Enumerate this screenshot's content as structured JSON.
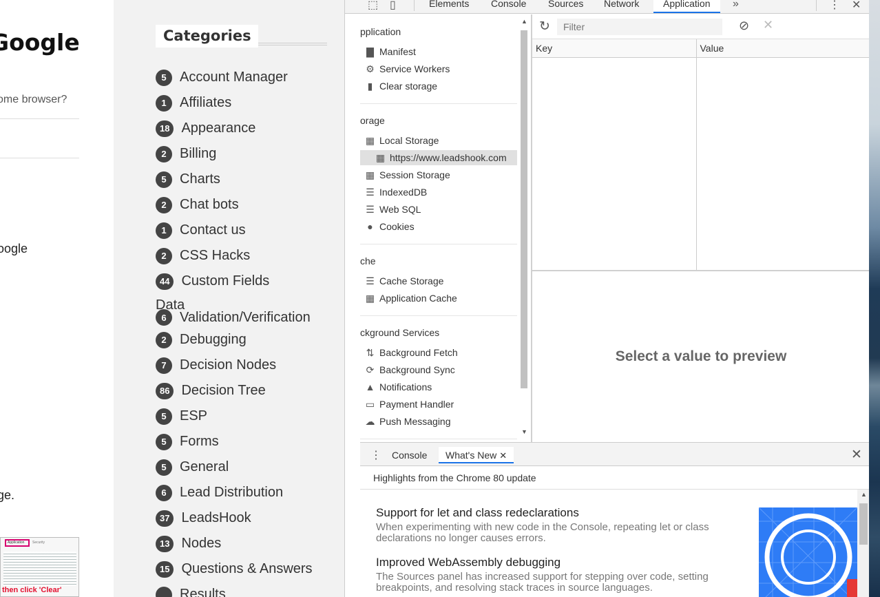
{
  "article": {
    "title_fragment": "Google",
    "question_fragment": "ome browser?",
    "text_fragment_1": "oogle",
    "text_fragment_2": "ge.",
    "thumbnail": {
      "tab_active": "Application",
      "tab_other": "Security",
      "caption": "then click 'Clear'"
    }
  },
  "categories": {
    "heading": "Categories",
    "items": [
      {
        "count": "5",
        "name": "Account Manager"
      },
      {
        "count": "1",
        "name": "Affiliates"
      },
      {
        "count": "18",
        "name": "Appearance"
      },
      {
        "count": "2",
        "name": "Billing"
      },
      {
        "count": "5",
        "name": "Charts"
      },
      {
        "count": "2",
        "name": "Chat bots"
      },
      {
        "count": "1",
        "name": "Contact us"
      },
      {
        "count": "2",
        "name": "CSS Hacks"
      },
      {
        "count": "44",
        "name": "Custom Fields"
      },
      {
        "prefix": "Data",
        "count": "6",
        "name": "Validation/Verification"
      },
      {
        "count": "2",
        "name": "Debugging"
      },
      {
        "count": "7",
        "name": "Decision Nodes"
      },
      {
        "count": "86",
        "name": "Decision Tree"
      },
      {
        "count": "5",
        "name": "ESP"
      },
      {
        "count": "5",
        "name": "Forms"
      },
      {
        "count": "5",
        "name": "General"
      },
      {
        "count": "6",
        "name": "Lead Distribution"
      },
      {
        "count": "37",
        "name": "LeadsHook"
      },
      {
        "count": "13",
        "name": "Nodes"
      },
      {
        "count": "15",
        "name": "Questions & Answers"
      },
      {
        "count": "",
        "name": "Results"
      }
    ]
  },
  "devtools": {
    "tabs": [
      "Elements",
      "Console",
      "Sources",
      "Network",
      "Application"
    ],
    "active_tab": "Application",
    "more_tabs_icon": "»",
    "sidebar": {
      "application": {
        "label": "pplication",
        "items": [
          {
            "icon": "file-icon",
            "label": "Manifest"
          },
          {
            "icon": "gear-icon",
            "label": "Service Workers"
          },
          {
            "icon": "trash-icon",
            "label": "Clear storage"
          }
        ]
      },
      "storage": {
        "label": "orage",
        "items": [
          {
            "icon": "grid-icon",
            "label": "Local Storage"
          },
          {
            "icon": "grid-icon",
            "label": "https://www.leadshook.com",
            "selected": true
          },
          {
            "icon": "grid-icon",
            "label": "Session Storage"
          },
          {
            "icon": "database-icon",
            "label": "IndexedDB"
          },
          {
            "icon": "database-icon",
            "label": "Web SQL"
          },
          {
            "icon": "cookie-icon",
            "label": "Cookies"
          }
        ]
      },
      "cache": {
        "label": "che",
        "items": [
          {
            "icon": "database-icon",
            "label": "Cache Storage"
          },
          {
            "icon": "grid-icon",
            "label": "Application Cache"
          }
        ]
      },
      "background": {
        "label": "ckground Services",
        "items": [
          {
            "icon": "arrows-updown-icon",
            "label": "Background Fetch"
          },
          {
            "icon": "sync-icon",
            "label": "Background Sync"
          },
          {
            "icon": "bell-icon",
            "label": "Notifications"
          },
          {
            "icon": "card-icon",
            "label": "Payment Handler"
          },
          {
            "icon": "cloud-icon",
            "label": "Push Messaging"
          }
        ]
      }
    },
    "storage_view": {
      "filter_placeholder": "Filter",
      "columns": [
        "Key",
        "Value"
      ],
      "preview_text": "Select a value to preview"
    },
    "drawer": {
      "tabs": [
        "Console",
        "What's New"
      ],
      "active_tab": "What's New",
      "subheading": "Highlights from the Chrome 80 update",
      "items": [
        {
          "title": "Support for let and class redeclarations",
          "body": "When experimenting with new code in the Console, repeating let or class declarations no longer causes errors."
        },
        {
          "title": "Improved WebAssembly debugging",
          "body": "The Sources panel has increased support for stepping over code, setting breakpoints, and resolving stack traces in source languages."
        }
      ]
    }
  },
  "colors": {
    "accent_blue": "#1a73e8",
    "badge_bg": "#444444",
    "sidebar_bg": "#f2f2f2",
    "highlight_red": "#e3102f"
  }
}
